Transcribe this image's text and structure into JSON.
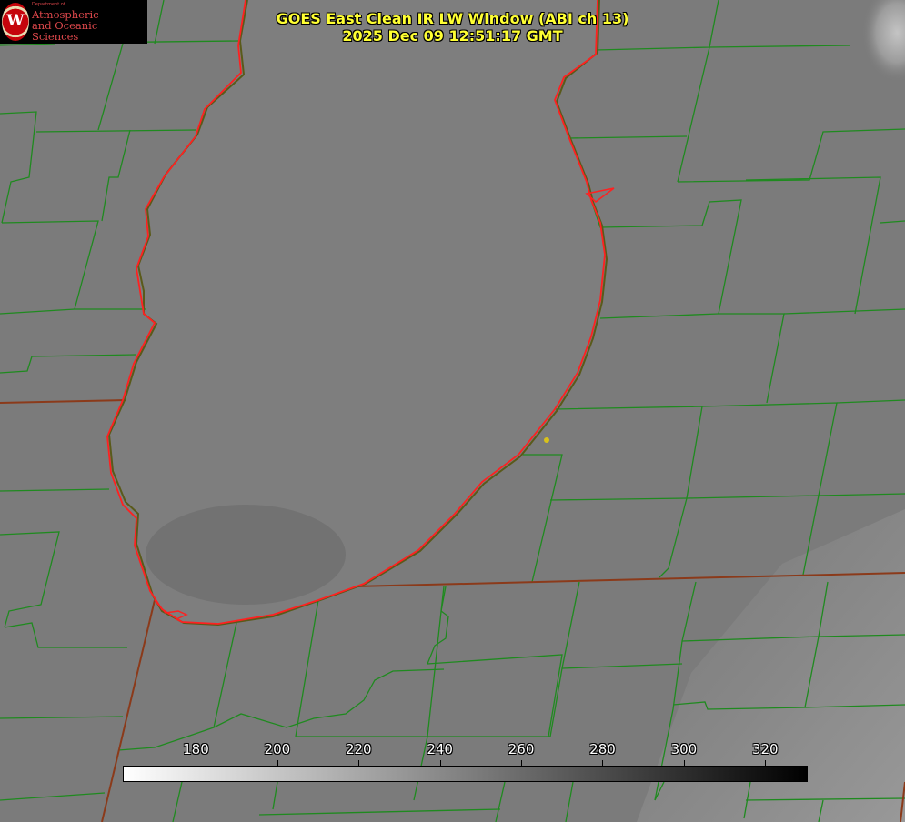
{
  "title": {
    "line1": "GOES East Clean IR LW Window (ABI ch 13)",
    "line2": "2025 Dec 09 12:51:17 GMT"
  },
  "logo": {
    "department": "Department of",
    "line1": "Atmospheric",
    "line2": "and Oceanic Sciences",
    "emblem_letter": "W"
  },
  "colorbar": {
    "min": 162,
    "max": 330,
    "ticks": [
      180,
      200,
      220,
      240,
      260,
      280,
      300,
      320
    ],
    "color_low": "#ffffff",
    "color_high": "#000000"
  },
  "colors": {
    "county_lines": "#1f8a1f",
    "state_lines": "#8b3a1a",
    "lake_outline": "#ff2020",
    "marker": "#d9c21a",
    "title_text": "#ffff33"
  }
}
